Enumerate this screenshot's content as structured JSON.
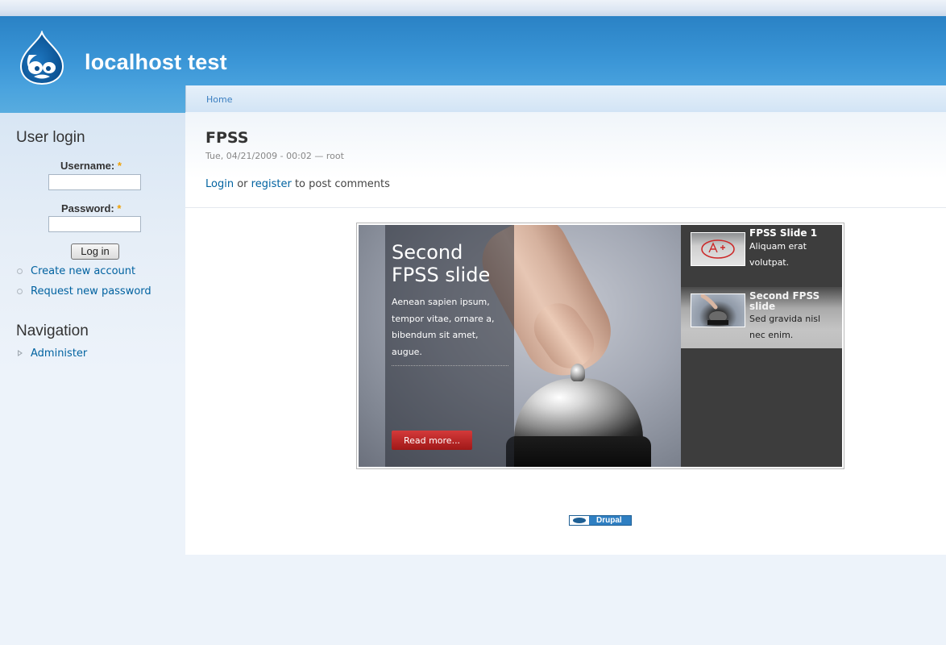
{
  "site": {
    "name": "localhost test"
  },
  "breadcrumb": {
    "home": "Home"
  },
  "user_login": {
    "title": "User login",
    "username_label": "Username:",
    "password_label": "Password:",
    "required_mark": "*",
    "username_value": "",
    "password_value": "",
    "login_button": "Log in",
    "links": [
      "Create new account",
      "Request new password"
    ]
  },
  "navigation": {
    "title": "Navigation",
    "items": [
      "Administer"
    ]
  },
  "node": {
    "title": "FPSS",
    "meta": "Tue, 04/21/2009 - 00:02 — root",
    "login_link": "Login",
    "or_text": "or",
    "register_link": "register",
    "post_comments_text": "to post comments"
  },
  "slideshow": {
    "active_slide": {
      "heading": "Second FPSS slide",
      "body": "Aenean sapien ipsum, tempor vitae, ornare a, bibendum sit amet, augue.",
      "read_more": "Read more..."
    },
    "thumbs": [
      {
        "title": "FPSS Slide 1",
        "text": "Aliquam erat volutpat."
      },
      {
        "title": "Second FPSS slide",
        "text": "Sed gravida nisl nec enim."
      }
    ]
  },
  "footer": {
    "badge": "Drupal"
  }
}
